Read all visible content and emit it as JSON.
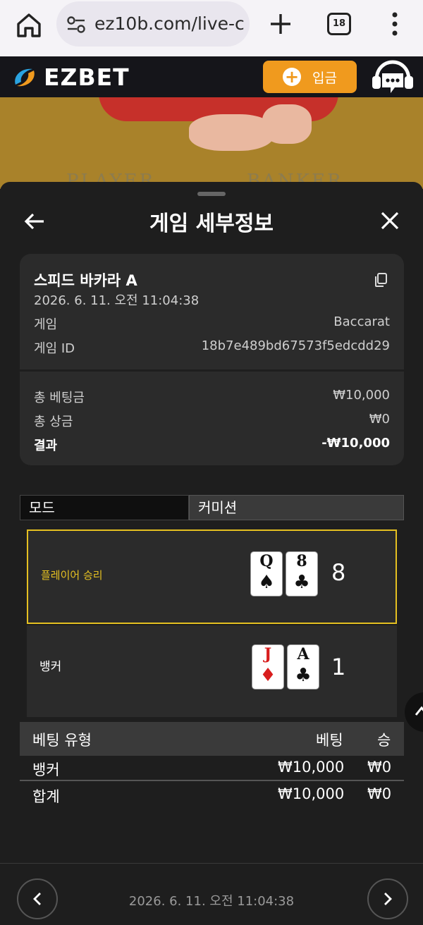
{
  "browser": {
    "url": "ez10b.com/live-c",
    "tab_count": "18"
  },
  "site": {
    "logo_text": "EZBET",
    "deposit_label": "입금"
  },
  "video": {
    "player_label": "PLAYER",
    "banker_label": "BANKER"
  },
  "sheet": {
    "title": "게임 세부정보"
  },
  "details": {
    "game_name": "스피드 바카라 A",
    "datetime": "2026. 6. 11. 오전 11:04:38",
    "game_label": "게임",
    "game_value": "Baccarat",
    "game_id_label": "게임 ID",
    "game_id_value": "18b7e489bd67573f5edcdd29",
    "total_bet_label": "총 베팅금",
    "total_bet_value": "₩10,000",
    "total_win_label": "총 상금",
    "total_win_value": "₩0",
    "result_label": "결과",
    "result_value": "-₩10,000"
  },
  "mode": {
    "mode_label": "모드",
    "commission_label": "커미션"
  },
  "hands": {
    "player": {
      "label": "플레이어 승리",
      "cards": [
        {
          "rank": "Q",
          "suit": "♠",
          "color": "#111111"
        },
        {
          "rank": "8",
          "suit": "♣",
          "color": "#111111"
        }
      ],
      "score": "8"
    },
    "banker": {
      "label": "뱅커",
      "cards": [
        {
          "rank": "J",
          "suit": "♦",
          "color": "#d81e1e"
        },
        {
          "rank": "A",
          "suit": "♣",
          "color": "#111111"
        }
      ],
      "score": "1"
    }
  },
  "bets": {
    "headers": [
      "베팅 유형",
      "베팅",
      "승"
    ],
    "rows": [
      {
        "type": "뱅커",
        "bet": "₩10,000",
        "win": "₩0"
      },
      {
        "type": "합계",
        "bet": "₩10,000",
        "win": "₩0"
      }
    ]
  },
  "footer": {
    "datetime": "2026. 6. 11. 오전 11:04:38"
  },
  "colors": {
    "accent_gold": "#e5c021",
    "deposit_orange": "#f09a1e"
  }
}
